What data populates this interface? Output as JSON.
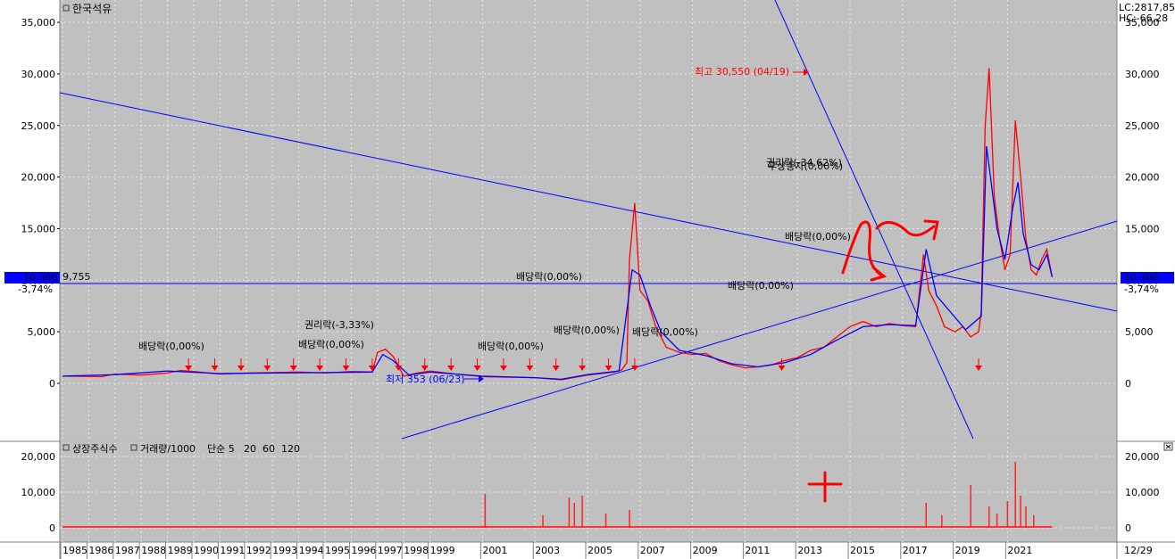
{
  "price_panel": {
    "title": "한국석유",
    "lc_label": "LC:2817,85",
    "hc_label": "HC:-66,28",
    "current_price": "10,300",
    "change_pct": "-3,74%",
    "line_value": "9,755",
    "high_label": "최고 30,550 (04/19)",
    "low_label": "최저 353 (06/23)",
    "annotations": [
      "배당락(0,00%)",
      "권리락(-3,33%)",
      "배당락(0,00%)",
      "배당락(0,00%)",
      "배당락(0,00%)",
      "배당락(0,00%)",
      "배당락(0,00%)",
      "배당락(0,00%)",
      "권리락(-34,62%)",
      "무상증자(0,00%)",
      "배당락(0,00%)"
    ]
  },
  "volume_panel": {
    "legend": [
      {
        "label": "상장주식수",
        "color": "#ff3333"
      },
      {
        "label": "거래량/1000",
        "color": "#3aa0a8"
      },
      {
        "label": "단순 5",
        "color": "#e040c0"
      },
      {
        "label": "20",
        "color": "#d4b020"
      },
      {
        "label": "60",
        "color": "#20a020"
      },
      {
        "label": "120",
        "color": "#808080"
      }
    ]
  },
  "date_end_label": "12/29",
  "chart_data": [
    {
      "type": "line",
      "title": "한국석유",
      "x_type": "year",
      "xlim": [
        1985,
        2023.5
      ],
      "ylim": [
        -5000,
        37000
      ],
      "y_ticks": [
        0,
        5000,
        10000,
        15000,
        20000,
        25000,
        30000,
        35000
      ],
      "y_tick_labels": [
        "0",
        "5,000",
        "10,000",
        "15,000",
        "20,000",
        "25,000",
        "30,000",
        "35,000"
      ],
      "x_tick_labels": [
        "1985",
        "1986",
        "1987",
        "1988",
        "1989",
        "1990",
        "1991",
        "1992",
        "1993",
        "1994",
        "1995",
        "1996",
        "1997",
        "1998",
        "1999",
        "2001",
        "2003",
        "2005",
        "2007",
        "2009",
        "2011",
        "2013",
        "2015",
        "2017",
        "2019",
        "2021"
      ],
      "grid": true,
      "series": [
        {
          "color": "#ff0000",
          "x": [
            1985,
            1986.5,
            1987,
            1988,
            1989,
            1989.5,
            1990,
            1991,
            1992,
            1993,
            1994,
            1995,
            1996,
            1996.8,
            1997.0,
            1997.3,
            1997.6,
            1998.0,
            1998.5,
            1999,
            2000,
            2001,
            2002,
            2003,
            2004,
            2005,
            2006,
            2006.3,
            2006.5,
            2006.6,
            2006.8,
            2007.0,
            2007.3,
            2007.6,
            2008,
            2008.5,
            2009,
            2009.5,
            2010,
            2010.5,
            2011,
            2011.5,
            2012,
            2012.5,
            2013,
            2013.5,
            2014,
            2014.5,
            2015,
            2015.5,
            2016,
            2016.5,
            2017,
            2017.5,
            2017.8,
            2018.0,
            2018.3,
            2018.6,
            2019,
            2019.3,
            2019.6,
            2019.9,
            2020.0,
            2020.15,
            2020.3,
            2020.5,
            2020.7,
            2020.9,
            2021.1,
            2021.3,
            2021.5,
            2021.7,
            2021.9,
            2022.1,
            2022.3,
            2022.5,
            2022.7
          ],
          "y": [
            700,
            650,
            900,
            800,
            1000,
            1250,
            1150,
            900,
            1000,
            1050,
            1100,
            1000,
            1150,
            1100,
            3000,
            3300,
            2600,
            700,
            1000,
            1200,
            900,
            650,
            600,
            550,
            350,
            800,
            1100,
            1300,
            2000,
            12000,
            17500,
            9000,
            8000,
            5500,
            3500,
            3000,
            2800,
            2900,
            2200,
            1800,
            1500,
            1600,
            1800,
            2200,
            2500,
            3200,
            3500,
            4500,
            5500,
            6000,
            5500,
            5800,
            5600,
            5500,
            12500,
            9000,
            7500,
            5500,
            5000,
            5500,
            4500,
            5000,
            7000,
            25000,
            30550,
            18000,
            14000,
            11000,
            12500,
            25500,
            20000,
            14000,
            11000,
            10500,
            12000,
            13000,
            10300
          ]
        },
        {
          "color": "#0000ff",
          "x": [
            1985,
            1987,
            1989,
            1991,
            1993,
            1995,
            1996.8,
            1997.2,
            1997.6,
            1998.2,
            1999,
            2001,
            2003,
            2004,
            2005,
            2006.2,
            2006.7,
            2007.0,
            2007.4,
            2007.8,
            2008.5,
            2009.5,
            2010.5,
            2011.5,
            2012.5,
            2013.5,
            2014.5,
            2015.5,
            2016.5,
            2017.5,
            2017.9,
            2018.3,
            2018.8,
            2019.4,
            2020.0,
            2020.2,
            2020.4,
            2020.6,
            2020.9,
            2021.2,
            2021.4,
            2021.6,
            2021.9,
            2022.2,
            2022.5,
            2022.7
          ],
          "y": [
            700,
            850,
            1200,
            950,
            1000,
            1050,
            1100,
            2800,
            2200,
            800,
            1100,
            700,
            550,
            400,
            850,
            1200,
            11000,
            10500,
            7500,
            5000,
            3200,
            2700,
            1900,
            1600,
            2000,
            2800,
            4200,
            5500,
            5700,
            5600,
            13000,
            8500,
            7000,
            5200,
            6500,
            23000,
            19000,
            15000,
            12000,
            17000,
            19500,
            14500,
            11500,
            11000,
            12500,
            10300
          ]
        }
      ],
      "annotations": [
        {
          "text": "최고 30,550 (04/19)",
          "x": 2020.3,
          "y": 30550,
          "color": "#ff0000"
        },
        {
          "text": "최저 353 (06/23)",
          "x": 2004.5,
          "y": 353,
          "color": "#0000ff"
        }
      ],
      "reference_line": 9755
    },
    {
      "type": "bar",
      "title": "",
      "ylim": [
        0,
        20000
      ],
      "y_ticks": [
        0,
        10000,
        20000
      ],
      "y_tick_labels": [
        "0",
        "10,000",
        "20,000"
      ],
      "x": [
        2001.1,
        2003.3,
        2004.3,
        2004.5,
        2004.8,
        2005.7,
        2006.6,
        2017.9,
        2018.5,
        2019.6,
        2020.3,
        2020.6,
        2021.0,
        2021.3,
        2021.5,
        2021.7,
        2022.0
      ],
      "values": [
        9500,
        3500,
        8500,
        7000,
        9000,
        4000,
        5000,
        7000,
        3500,
        12000,
        6000,
        4000,
        7500,
        18500,
        9000,
        6000,
        3500
      ]
    }
  ]
}
